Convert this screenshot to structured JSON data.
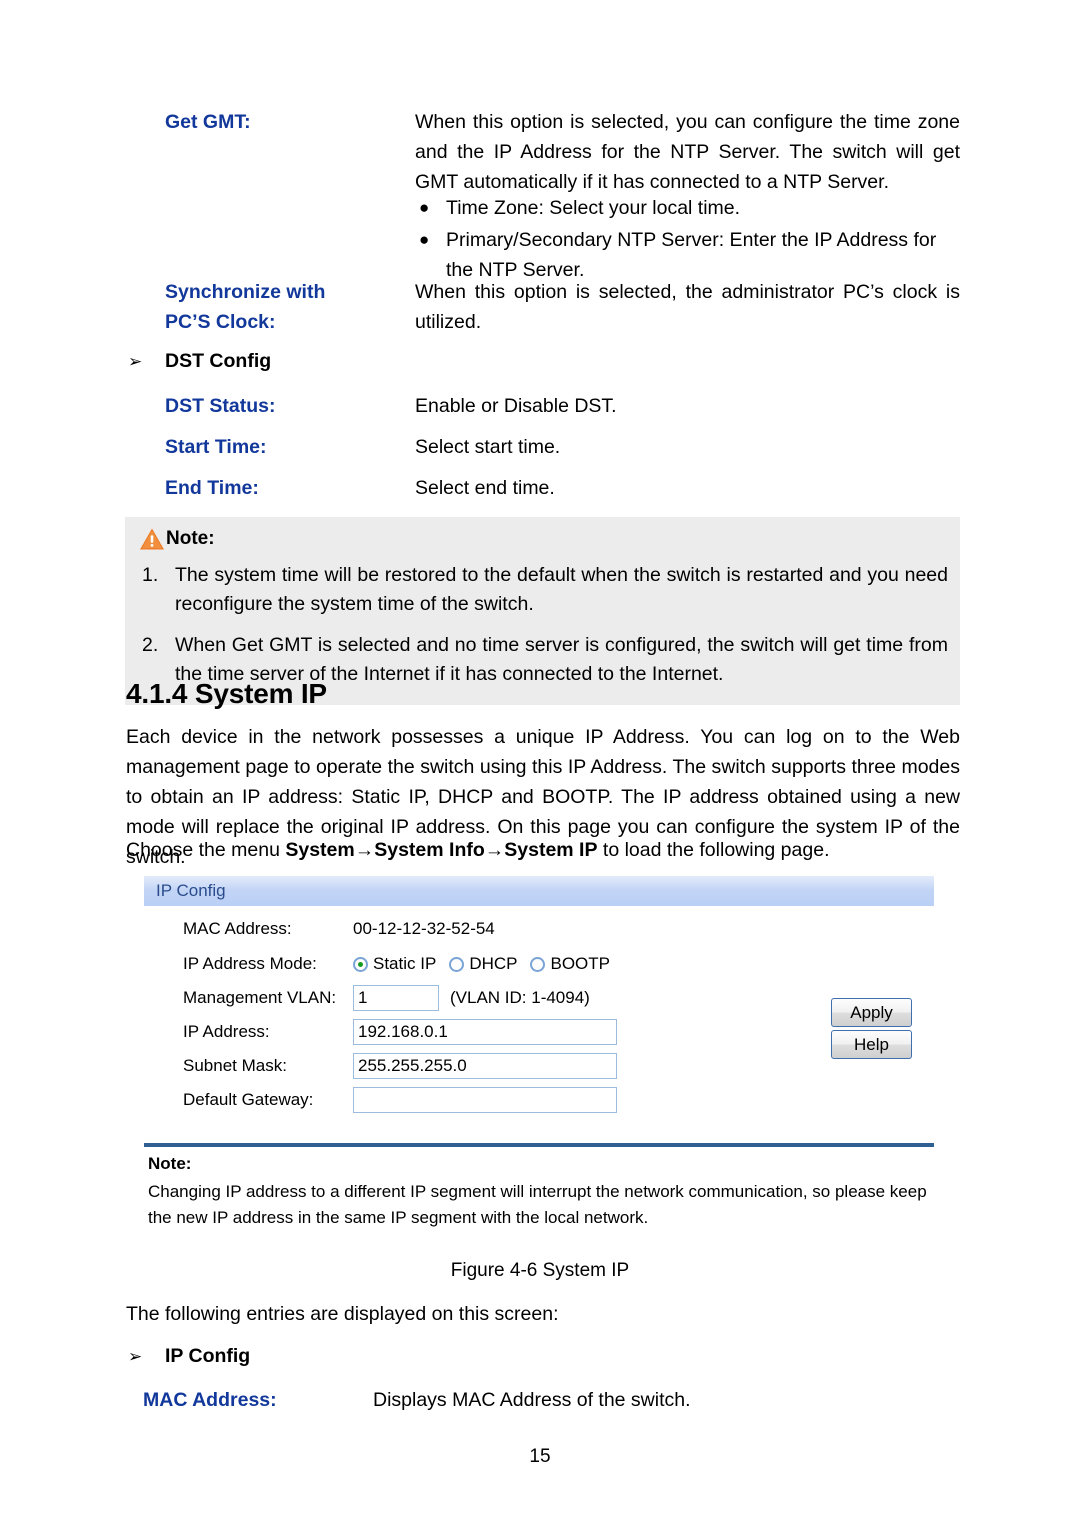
{
  "definitions": [
    {
      "term": "Get GMT:",
      "term_line2": "",
      "desc": "When this option is selected, you can configure the time zone and the IP Address for the NTP Server. The switch will get GMT automatically if it has connected to a NTP Server.",
      "bullets": [
        "Time Zone: Select your local time.",
        "Primary/Secondary NTP Server: Enter the IP Address for the NTP Server."
      ]
    },
    {
      "term": "Synchronize with",
      "term_line2": "PC’S Clock:",
      "desc": "When this option is selected, the administrator PC’s clock is utilized."
    },
    {
      "term": "DST Status:",
      "term_line2": "",
      "desc": "Enable or Disable DST."
    },
    {
      "term": "Start Time:",
      "term_line2": "",
      "desc": "Select start time."
    },
    {
      "term": "End Time:",
      "term_line2": "",
      "desc": "Select end time."
    }
  ],
  "dst_config_heading": {
    "arrow": "➢",
    "label": "DST Config"
  },
  "note_box": {
    "icon": "warning-triangle-icon",
    "label": "Note:",
    "items": [
      {
        "num": "1.",
        "text": "The system time will be restored to the default when the switch is restarted and you need reconfigure the system time of the switch."
      },
      {
        "num": "2.",
        "text": "When Get GMT is selected and no time server is configured, the switch will get time from the time server of the Internet if it has connected to the Internet."
      }
    ]
  },
  "section": {
    "heading": "4.1.4 System IP",
    "paragraph": "Each device in the network possesses a unique IP Address. You can log on to the Web management page to operate the switch using this IP Address. The switch supports three modes to obtain an IP address: Static IP, DHCP and BOOTP. The IP address obtained using a new mode will replace the original IP address. On this page you can configure the system IP of the switch.",
    "menu_intro": "Choose the menu ",
    "menu_path": "System→System Info→System IP",
    "menu_outro": " to load the following page."
  },
  "screenshot": {
    "panel_title": "IP Config",
    "rows": {
      "mac_label": "MAC Address:",
      "mac_value": "00-12-12-32-52-54",
      "mode_label": "IP Address Mode:",
      "vlan_label": "Management VLAN:",
      "vlan_value": "1",
      "vlan_hint": "(VLAN ID: 1-4094)",
      "ip_label": "IP Address:",
      "ip_value": "192.168.0.1",
      "mask_label": "Subnet Mask:",
      "mask_value": "255.255.255.0",
      "gw_label": "Default Gateway:",
      "gw_value": ""
    },
    "modes": [
      {
        "label": "Static IP",
        "selected": true
      },
      {
        "label": "DHCP",
        "selected": false
      },
      {
        "label": "BOOTP",
        "selected": false
      }
    ],
    "buttons": {
      "apply": "Apply",
      "help": "Help"
    },
    "note_title": "Note:",
    "note_body": "Changing IP address to a different IP segment will interrupt the network communication, so please keep the new IP address in the same IP segment with the local network.",
    "colors": {
      "title_bar_start": "#e4ecfb",
      "title_bar_end": "#b9cff5",
      "title_text": "#2b4c8c",
      "rule": "#2e6094",
      "field_border": "#9dbbdc",
      "radio_dot": "#169c20"
    }
  },
  "figure_caption": "Figure 4-6 System IP",
  "closing": {
    "intro": "The following entries are displayed on this screen:",
    "ip_config_heading": {
      "arrow": "➢",
      "label": "IP Config"
    },
    "mac_term": "MAC Address:",
    "mac_desc": "Displays MAC Address of the switch."
  },
  "page_number": "15",
  "theme": {
    "term_blue": "#12389b",
    "note_bg": "#ececed",
    "warn_orange": "#ec7b26"
  }
}
